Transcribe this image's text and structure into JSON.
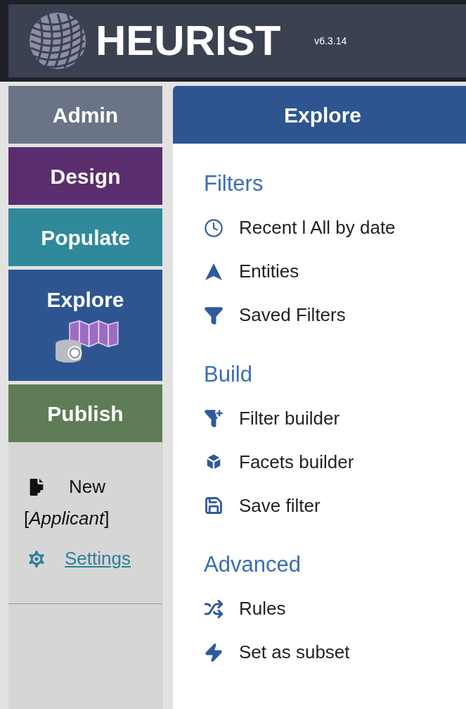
{
  "header": {
    "logo_text": "HEURIST",
    "version": "v6.3.14"
  },
  "menu": [
    {
      "label": "Admin",
      "color": "#6b7487",
      "selected": false
    },
    {
      "label": "Design",
      "color": "#5a2e6c",
      "selected": false
    },
    {
      "label": "Populate",
      "color": "#30899b",
      "selected": false
    },
    {
      "label": "Explore",
      "color": "#2e5590",
      "selected": true
    },
    {
      "label": "Publish",
      "color": "#5e7c56",
      "selected": false
    }
  ],
  "sidebar_actions": {
    "new_label": "New",
    "record_type": "[*Applicant*]",
    "settings_link": "Settings"
  },
  "panel": {
    "title": "Explore",
    "sections": [
      {
        "title": "Filters",
        "items": [
          {
            "label": "Recent l All by date",
            "kind": "clock"
          },
          {
            "label": "Entities",
            "kind": "entities"
          },
          {
            "label": "Saved Filters",
            "kind": "funnel"
          }
        ]
      },
      {
        "title": "Build",
        "items": [
          {
            "label": "Filter builder",
            "kind": "funnel-plus"
          },
          {
            "label": "Facets builder",
            "kind": "cube"
          },
          {
            "label": "Save filter",
            "kind": "floppy"
          }
        ]
      },
      {
        "title": "Advanced",
        "items": [
          {
            "label": "Rules",
            "kind": "shuffle"
          },
          {
            "label": "Set as subset",
            "kind": "bolt"
          }
        ]
      }
    ]
  }
}
